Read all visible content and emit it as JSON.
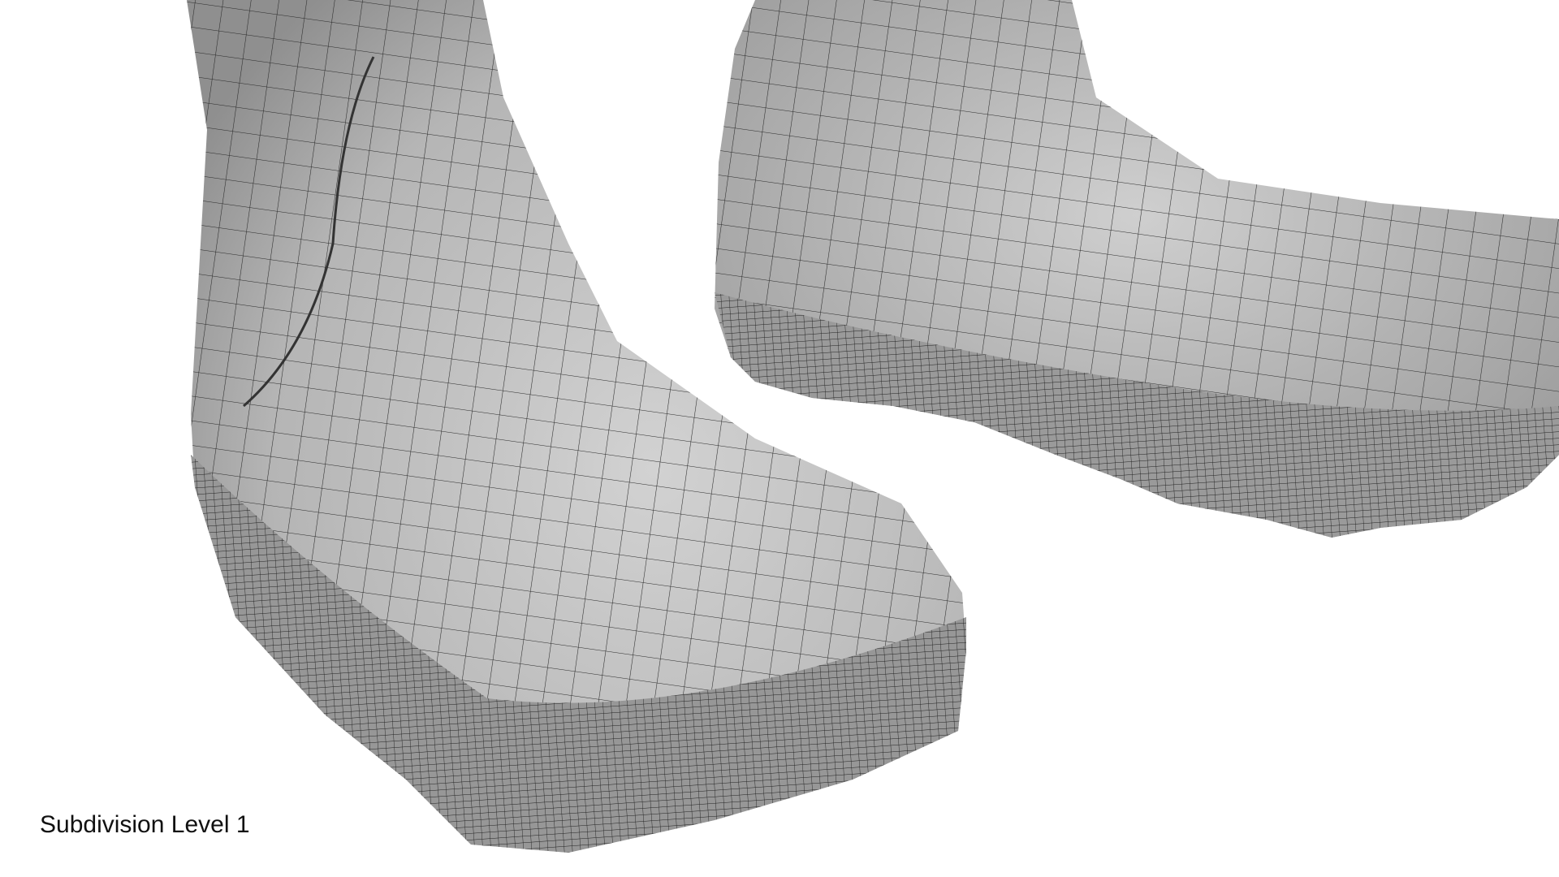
{
  "caption": "Subdivision Level 1",
  "colors": {
    "background": "#ffffff",
    "mesh_fill": "#b9b9b9",
    "mesh_shadow": "#8f8f8f",
    "wire": "#2a2a2a"
  }
}
